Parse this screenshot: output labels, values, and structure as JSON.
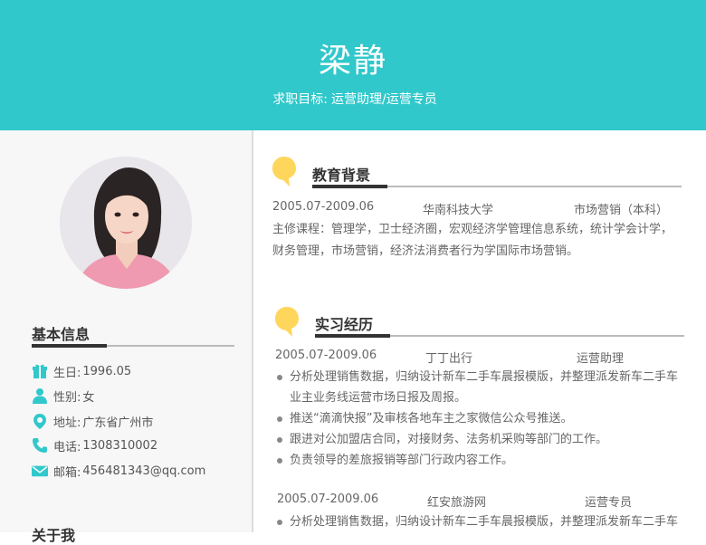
{
  "header": {
    "name": "梁静",
    "goal_label": "求职目标:",
    "goal_value": "运营助理/运营专员",
    "bg_color": "#31c8cb"
  },
  "left": {
    "basic_title": "基本信息",
    "about_title": "关于我",
    "info": [
      {
        "icon": "gift-icon",
        "label": "生日:",
        "value": "1996.05"
      },
      {
        "icon": "person-icon",
        "label": "性别:",
        "value": "女"
      },
      {
        "icon": "location-pin-icon",
        "label": "地址:",
        "value": "广东省广州市"
      },
      {
        "icon": "phone-icon",
        "label": "电话:",
        "value": "1308310002"
      },
      {
        "icon": "mail-icon",
        "label": "邮箱:",
        "value": "456481343@qq.com"
      }
    ]
  },
  "education": {
    "title": "教育背景",
    "date": "2005.07-2009.06",
    "school": "华南科技大学",
    "major": "市场营销（本科）",
    "courses_line1": "主修课程：管理学，卫士经济圈，宏观经济学管理信息系统，统计学会计学，",
    "courses_line2": "财务管理，市场营销，经济法消费者行为学国际市场营销。"
  },
  "internship": {
    "title": "实习经历",
    "jobs": [
      {
        "date": "2005.07-2009.06",
        "company": "丁丁出行",
        "position": "运营助理",
        "bullets": [
          "分析处理销售数据，归纳设计新车二手车晨报模版，并整理派发新车二手车",
          "业主业务线运营市场日报及周报。",
          "推送“滴滴快报”及审核各地车主之家微信公众号推送。",
          "跟进对公加盟店合同，对接财务、法务机采购等部门的工作。",
          "负责领导的差旅报销等部门行政内容工作。"
        ]
      },
      {
        "date": "2005.07-2009.06",
        "company": "红安旅游网",
        "position": "运营专员",
        "bullets": [
          "分析处理销售数据，归纳设计新车二手车晨报模版，并整理派发新车二手车"
        ]
      }
    ]
  },
  "accent_yellow": "#ffd65c"
}
